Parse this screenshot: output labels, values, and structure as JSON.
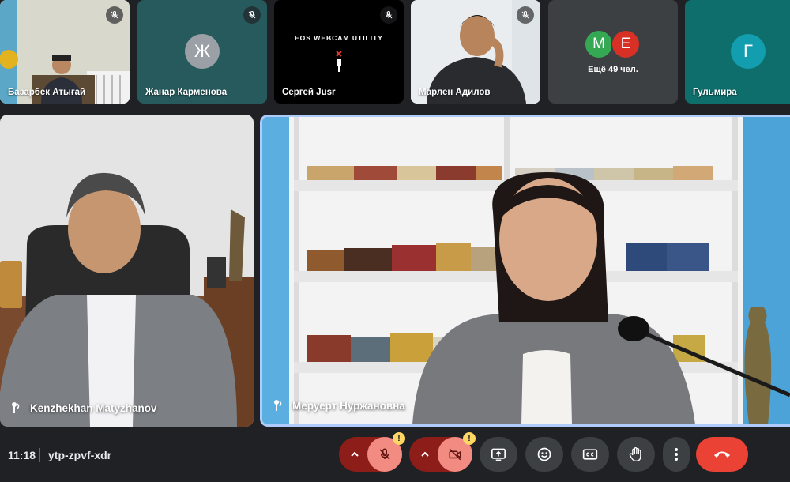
{
  "participants_strip": [
    {
      "name": "Базарбек Атығай",
      "muted": true
    },
    {
      "name": "Жанар Карменова",
      "initial": "Ж",
      "muted": true
    },
    {
      "name": "Сергей Jusr",
      "muted": true,
      "overlay_text": "EOS WEBCAM UTILITY"
    },
    {
      "name": "Марлен Адилов",
      "muted": true
    },
    {
      "more_label": "Ещё 49 чел.",
      "avatars": [
        "M",
        "E"
      ]
    },
    {
      "name": "Гульмира",
      "initial": "Г"
    }
  ],
  "main_tiles": [
    {
      "name": "Kenzhekhan Matyzhanov"
    },
    {
      "name": "Меруерт Нуржановна"
    }
  ],
  "bottom_bar": {
    "time": "11:18",
    "meeting_code": "ytp-zpvf-xdr",
    "warning_badge": "!"
  },
  "colors": {
    "background": "#202124",
    "control_gray": "#3c4043",
    "mic_off_red": "#ea4335",
    "end_call_red": "#ea4335",
    "avatar_teal": "#129eaf",
    "avatar_green": "#34a853",
    "avatar_red": "#d93025",
    "warning_yellow": "#fdd663"
  }
}
